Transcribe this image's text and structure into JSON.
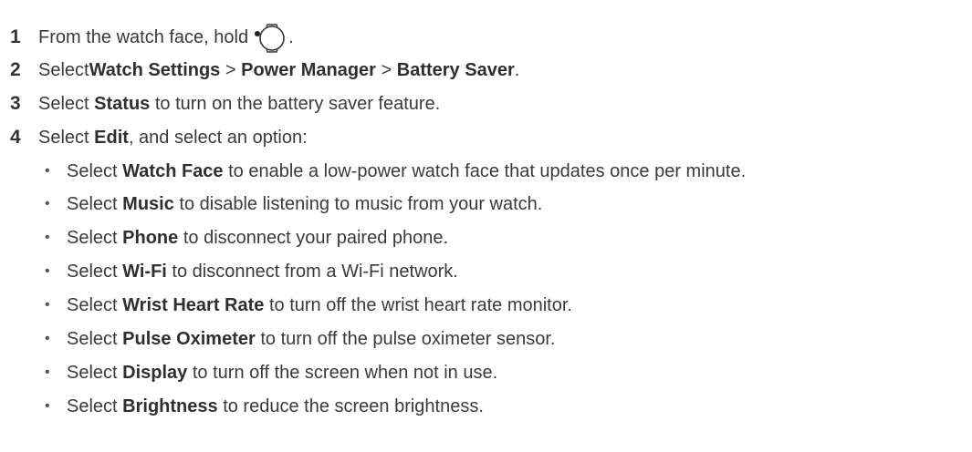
{
  "steps": [
    {
      "num": "1",
      "parts": [
        {
          "t": "From the watch face, hold "
        }
      ],
      "icon": "watch-button-icon",
      "after_icon": "."
    },
    {
      "num": "2",
      "parts": [
        {
          "t": "Select "
        },
        {
          "b": "Watch Settings"
        },
        {
          "t": " > "
        },
        {
          "b": "Power Manager"
        },
        {
          "t": " > "
        },
        {
          "b": "Battery Saver"
        },
        {
          "t": "."
        }
      ]
    },
    {
      "num": "3",
      "parts": [
        {
          "t": "Select "
        },
        {
          "b": "Status"
        },
        {
          "t": " to turn on the battery saver feature."
        }
      ]
    },
    {
      "num": "4",
      "parts": [
        {
          "t": "Select "
        },
        {
          "b": "Edit"
        },
        {
          "t": ", and select an option:"
        }
      ]
    }
  ],
  "options": [
    {
      "pre": "Select ",
      "b": "Watch Face",
      "post": " to enable a low-power watch face that updates once per minute."
    },
    {
      "pre": "Select ",
      "b": "Music",
      "post": " to disable listening to music from your watch."
    },
    {
      "pre": "Select ",
      "b": "Phone",
      "post": " to disconnect your paired phone."
    },
    {
      "pre": "Select ",
      "b": "Wi-Fi",
      "post": " to disconnect from a Wi-Fi network."
    },
    {
      "pre": "Select ",
      "b": "Wrist Heart Rate",
      "post": " to turn off the wrist heart rate monitor."
    },
    {
      "pre": "Select ",
      "b": "Pulse Oximeter",
      "post": " to turn off the pulse oximeter sensor."
    },
    {
      "pre": "Select ",
      "b": "Display",
      "post": " to turn off the screen when not in use."
    },
    {
      "pre": "Select ",
      "b": "Brightness",
      "post": " to reduce the screen brightness."
    }
  ],
  "bullet": "•"
}
